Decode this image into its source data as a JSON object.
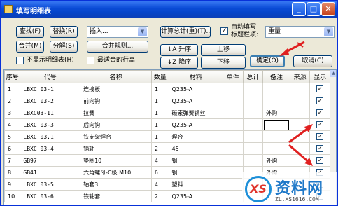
{
  "window": {
    "title": "填写明细表",
    "minimize": "_",
    "maximize": "□",
    "close": "✕"
  },
  "toolbar": {
    "find": "查找(F)",
    "replace": "替换(R)",
    "insert_combo": "插入...",
    "total_calc": "计算总计(重)(T)...",
    "auto_fill_label_line1": "自动填写",
    "auto_fill_label_line2": "标题栏项:",
    "auto_fill_value": "重量",
    "merge": "合并(M)",
    "split": "分解(S)",
    "merge_rules": "合并规则...",
    "sort_asc": "升序",
    "sort_desc": "降序",
    "move_up": "上移",
    "move_down": "下移",
    "ok": "确定(O)",
    "cancel": "取消(C)",
    "hide_detail_label": "不显示明细表(H)",
    "fit_row_height_label": "最适合的行高"
  },
  "table": {
    "columns": [
      "序号",
      "代号",
      "名称",
      "数量",
      "材料",
      "单件",
      "总计",
      "备注",
      "来源",
      "显示"
    ],
    "rows": [
      {
        "no": "1",
        "code": "LBXC 03-1",
        "name": "连接板",
        "qty": "1",
        "material": "Q235-A",
        "unit": "",
        "total": "",
        "note": "",
        "source": "",
        "show": true
      },
      {
        "no": "2",
        "code": "LBXC 03-2",
        "name": "前向钩",
        "qty": "1",
        "material": "Q235-A",
        "unit": "",
        "total": "",
        "note": "",
        "source": "",
        "show": true
      },
      {
        "no": "3",
        "code": "LBXC03-11",
        "name": "拉簧",
        "qty": "1",
        "material": "碳素弹簧钢丝",
        "unit": "",
        "total": "",
        "note": "外购",
        "source": "",
        "show": true
      },
      {
        "no": "4",
        "code": "LBXC 03-3",
        "name": "后向钩",
        "qty": "1",
        "material": "Q235-A",
        "unit": "",
        "total": "",
        "note": "",
        "source": "",
        "show": true
      },
      {
        "no": "5",
        "code": "LBXC 03.1",
        "name": "铁支架焊合",
        "qty": "1",
        "material": "焊合",
        "unit": "",
        "total": "",
        "note": "",
        "source": "",
        "show": true
      },
      {
        "no": "6",
        "code": "LBXC 03-4",
        "name": "销轴",
        "qty": "2",
        "material": "45",
        "unit": "",
        "total": "",
        "note": "",
        "source": "",
        "show": true
      },
      {
        "no": "7",
        "code": "GB97",
        "name": "垫圈10",
        "qty": "4",
        "material": "钢",
        "unit": "",
        "total": "",
        "note": "外购",
        "source": "",
        "show": true
      },
      {
        "no": "8",
        "code": "GB41",
        "name": "六角螺母-C级 M10",
        "qty": "6",
        "material": "钢",
        "unit": "",
        "total": "",
        "note": "外购",
        "source": "",
        "show": true
      },
      {
        "no": "9",
        "code": "LBXC 03-5",
        "name": "轴套3",
        "qty": "4",
        "material": "塑料",
        "unit": "",
        "total": "",
        "note": "",
        "source": "",
        "show": true
      },
      {
        "no": "10",
        "code": "LBXC 03-6",
        "name": "铁轴套",
        "qty": "2",
        "material": "Q235-A",
        "unit": "",
        "total": "",
        "note": "",
        "source": "",
        "show": true
      }
    ]
  },
  "watermark": {
    "title": "资料网",
    "url": "ZL.XS1616.COM"
  },
  "colors": {
    "titlebar": "#0a4bd6",
    "annotation_arrow": "#e02020",
    "dialog_bg": "#ece9d8"
  }
}
